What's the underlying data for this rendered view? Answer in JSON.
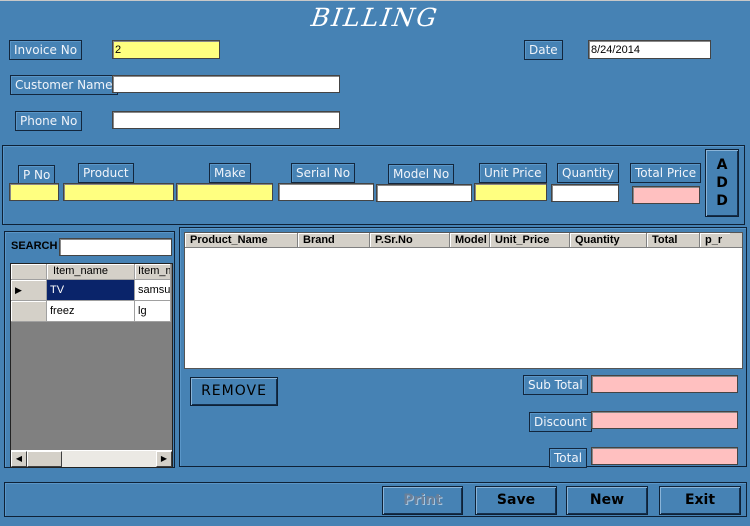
{
  "title": "BILLING",
  "header": {
    "invoice_label": "Invoice No",
    "invoice_value": "2",
    "date_label": "Date",
    "date_value": "8/24/2014",
    "customer_label": "Customer Name",
    "customer_value": "",
    "phone_label": "Phone No",
    "phone_value": ""
  },
  "entry": {
    "pno_label": "P No",
    "product_label": "Product",
    "make_label": "Make",
    "serial_label": "Serial No",
    "model_label": "Model No",
    "unit_price_label": "Unit Price",
    "quantity_label": "Quantity",
    "total_price_label": "Total Price",
    "add_letters": [
      "A",
      "D",
      "D"
    ],
    "values": {
      "pno": "",
      "product": "",
      "make": "",
      "serial": "",
      "model": "",
      "unit_price": "",
      "quantity": "",
      "total_price": ""
    }
  },
  "search": {
    "label": "SEARCH",
    "value": "",
    "columns": [
      "Item_name",
      "Item_m"
    ],
    "rows": [
      {
        "indicator": "▶",
        "cells": [
          "TV",
          "samsun"
        ],
        "selected": true
      },
      {
        "indicator": "",
        "cells": [
          "freez",
          "lg"
        ],
        "selected": false
      }
    ],
    "scroll_left": "◀",
    "scroll_right": "▶"
  },
  "bill_grid": {
    "columns": [
      "Product_Name",
      "Brand",
      "P.Sr.No",
      "Model",
      "Unit_Price",
      "Quantity",
      "Total",
      "p_r"
    ],
    "rows": []
  },
  "remove_label": "REMOVE",
  "totals": {
    "subtotal_label": "Sub Total",
    "discount_label": "Discount",
    "total_label": "Total",
    "subtotal_value": "",
    "discount_value": "",
    "total_value": ""
  },
  "footer": {
    "print_label": "Print",
    "save_label": "Save",
    "new_label": "New",
    "exit_label": "Exit"
  },
  "colors": {
    "background": "#4682b4",
    "required_field": "#ffff80",
    "computed_field": "#ffc0c0",
    "selection": "#0a246a"
  }
}
